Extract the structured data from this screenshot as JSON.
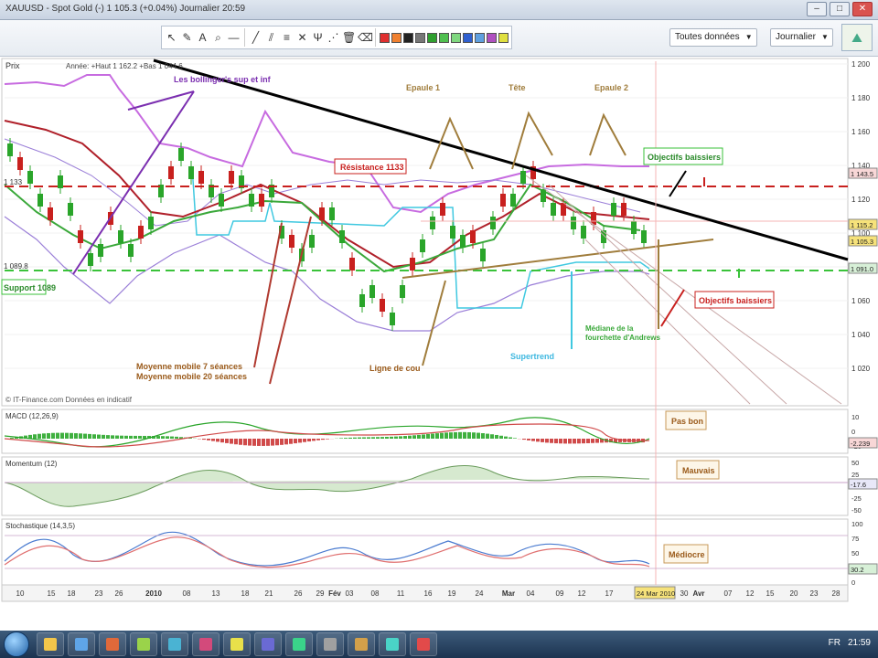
{
  "window": {
    "title": "XAUUSD - Spot Gold (-) 1 105.3 (+0.04%) Journalier 20:59"
  },
  "toolbar": {
    "data_select": "Toutes données",
    "period_select": "Journalier"
  },
  "main_panel": {
    "header_label": "Prix",
    "header_info": "Année: +Haut 1 162.2 +Bas 1 044.6",
    "footer": "© IT-Finance.com Données en indicatif",
    "price_axis": [
      "1 200",
      "1 180",
      "1 160",
      "1 140",
      "1 120",
      "1 100",
      "1 080",
      "1 060",
      "1 040",
      "1 020"
    ],
    "price_tags": [
      "1 143.5",
      "1 115.2",
      "1 105.3",
      "1 091.0"
    ],
    "left_price_tags": [
      "1 133",
      "1 089.8"
    ],
    "annotations": {
      "bollinger": "Les bollinger's sup et inf",
      "shoulder1": "Epaule 1",
      "head": "Tête",
      "shoulder2": "Epaule 2",
      "resistance": "Résistance 1133",
      "obj_bear_top": "Objectifs baissiers",
      "obj_bear_bottom": "Objectifs baissiers",
      "support": "Support 1089",
      "ma": "Moyenne mobile 7 séances\nMoyenne mobile 20 séances",
      "neckline": "Ligne de cou",
      "supertrend": "Supertrend",
      "andrews": "Médiane de la fourchette d'Andrews"
    }
  },
  "indicators": {
    "macd": {
      "label": "MACD (12,26,9)",
      "note": "Pas bon",
      "value": "-2.239",
      "axis": [
        "10",
        "0",
        "-10"
      ]
    },
    "momentum": {
      "label": "Momentum (12)",
      "note": "Mauvais",
      "value": "-17.6",
      "axis": [
        "50",
        "25",
        "0",
        "-25",
        "-50"
      ]
    },
    "stochastic": {
      "label": "Stochastique (14,3,5)",
      "note": "Médiocre",
      "value": "30.2",
      "axis": [
        "100",
        "75",
        "50",
        "25",
        "0"
      ]
    }
  },
  "time_axis": [
    "10",
    "15",
    "18",
    "23",
    "26",
    "2010",
    "08",
    "13",
    "18",
    "21",
    "26",
    "29",
    "Fév",
    "03",
    "08",
    "11",
    "16",
    "19",
    "24",
    "Mar",
    "04",
    "09",
    "12",
    "17",
    "24 Mar 2010",
    "30",
    "Avr",
    "07",
    "12",
    "15",
    "20",
    "23",
    "28"
  ],
  "taskbar": {
    "lang": "FR",
    "clock": "21:59"
  },
  "colors": {
    "bull": "#2aa52a",
    "bear": "#c8201e",
    "bollinger": "#c76be0",
    "resistance": "#c8201e",
    "support": "#3ac23a",
    "trend": "#000000",
    "supertrend": "#3fc8e0",
    "neckline": "#a07d3c",
    "ma_fast": "#3aa83a",
    "ma_slow": "#b0202a"
  },
  "icons": [
    "cursor-icon",
    "pencil-icon",
    "text-icon",
    "zoom-icon",
    "line-icon",
    "trash-icon",
    "color-swatch-icon"
  ]
}
